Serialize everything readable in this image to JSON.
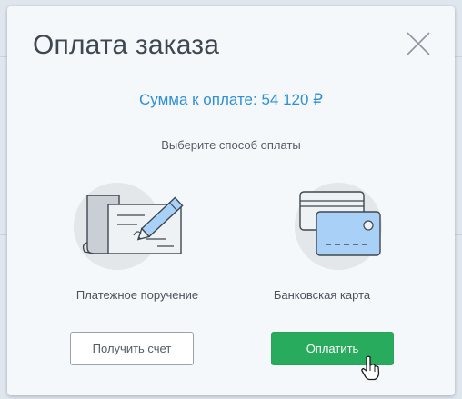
{
  "modal": {
    "title": "Оплата заказа",
    "close_icon": "close-x-icon",
    "sum_label": "Сумма к оплате: 54 120 ₽",
    "choose_label": "Выберите способ оплаты"
  },
  "methods": [
    {
      "id": "payment-order",
      "icon": "payment-order-pen-icon",
      "label": "Платежное поручение"
    },
    {
      "id": "bank-card",
      "icon": "bank-card-icon",
      "label": "Банковская карта"
    }
  ],
  "buttons": {
    "invoice_label": "Получить счет",
    "pay_label": "Оплатить"
  },
  "colors": {
    "accent_blue": "#2f8fd4",
    "pay_green": "#29ab5d",
    "card_blue": "#a9d0f7",
    "illustration_stroke": "#3f4850",
    "circle_bg": "#e4e7ea"
  }
}
